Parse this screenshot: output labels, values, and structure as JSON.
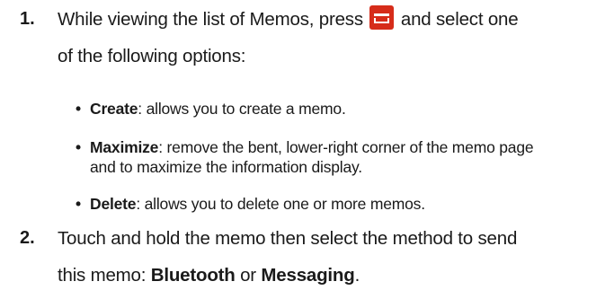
{
  "steps": [
    {
      "number": "1.",
      "line1_before_icon": "While viewing the list of Memos, press",
      "icon": "menu-key-icon",
      "line1_after_icon": "and select one",
      "line2": "of the following options:",
      "bullets": [
        {
          "term": "Create",
          "desc_line1": ": allows you to create a memo.",
          "desc_line2": ""
        },
        {
          "term": "Maximize",
          "desc_line1": ": remove the bent, lower-right corner of the memo page",
          "desc_line2": "and to maximize the information display."
        },
        {
          "term": "Delete",
          "desc_line1": ": allows you to delete one or more memos.",
          "desc_line2": ""
        }
      ]
    },
    {
      "number": "2.",
      "line1": "Touch and hold the memo then select the method to send",
      "line2_before": "this memo: ",
      "option1": "Bluetooth",
      "connector": " or ",
      "option2": "Messaging",
      "line2_after": "."
    }
  ],
  "colors": {
    "text": "#1a1a1a",
    "menu_key_background": "#d62c1a"
  }
}
